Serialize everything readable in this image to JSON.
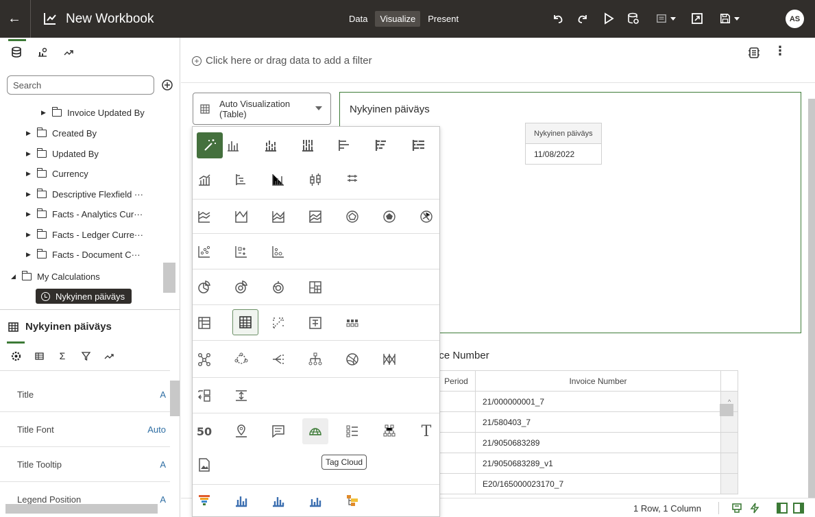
{
  "header": {
    "title": "New Workbook",
    "modes": [
      "Data",
      "Visualize",
      "Present"
    ],
    "active_mode": "Visualize",
    "user_initials": "AS"
  },
  "data_panel": {
    "search_placeholder": "Search",
    "tree": [
      {
        "label": "Invoice Updated By",
        "level": 2
      },
      {
        "label": "Created By",
        "level": 1
      },
      {
        "label": "Updated By",
        "level": 1
      },
      {
        "label": "Currency",
        "level": 1
      },
      {
        "label": "Descriptive Flexfield ···",
        "level": 1
      },
      {
        "label": "Facts - Analytics Cur···",
        "level": 1
      },
      {
        "label": "Facts - Ledger Curre···",
        "level": 1
      },
      {
        "label": "Facts - Document C···",
        "level": 1
      },
      {
        "label": "My Calculations",
        "level": 0,
        "expanded": true
      }
    ],
    "selected_item": "Nykyinen päiväys"
  },
  "properties": {
    "title": "Nykyinen päiväys",
    "rows": [
      {
        "label": "Title",
        "value": "A"
      },
      {
        "label": "Title Font",
        "value": "Auto"
      },
      {
        "label": "Title Tooltip",
        "value": "A"
      },
      {
        "label": "Legend Position",
        "value": "A"
      }
    ]
  },
  "canvas": {
    "filter_hint": "Click here or drag data to add a filter",
    "viz_type_selector": {
      "line1": "Auto Visualization",
      "line2": "(Table)"
    },
    "viz1": {
      "title": "Nykyinen päiväys",
      "header": "Nykyinen päiväys",
      "value": "11/08/2022"
    },
    "viz2": {
      "title_fragment": "ice Number",
      "columns": [
        "Period",
        "Invoice Number"
      ],
      "rows": [
        "21/000000001_7",
        "21/580403_7",
        "21/9050683289",
        "21/9050683289_v1",
        "E20/165000023170_7"
      ]
    },
    "status": "1 Row, 1 Column"
  },
  "picker": {
    "tooltip": "Tag Cloud",
    "count_label": "50"
  },
  "colors": {
    "topbar": "#312e2b",
    "accent_green": "#3c7a36",
    "link_blue": "#2f6ea3"
  }
}
